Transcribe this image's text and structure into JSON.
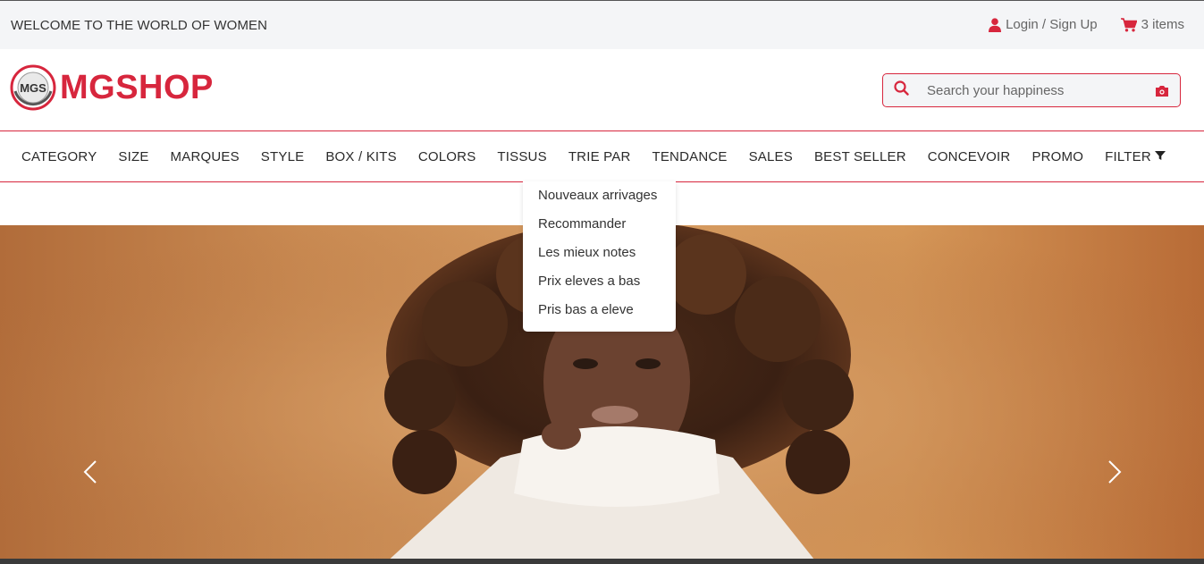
{
  "topbar": {
    "welcome": "WELCOME TO THE WORLD OF WOMEN",
    "login": {
      "label": "Login / Sign Up",
      "icon": "user-icon"
    },
    "cart": {
      "label": "3 items",
      "icon": "cart-icon"
    }
  },
  "header": {
    "logo_badge": "MGS",
    "logo_text": "MGSHOP",
    "search": {
      "placeholder": "Search your happiness",
      "value": ""
    }
  },
  "nav": {
    "items": [
      "CATEGORY",
      "SIZE",
      "MARQUES",
      "STYLE",
      "BOX / KITS",
      "COLORS",
      "TISSUS",
      "TRIE PAR",
      "TENDANCE",
      "SALES",
      "BEST SELLER",
      "CONCEVOIR",
      "PROMO",
      "FILTER"
    ]
  },
  "dropdown": {
    "items": [
      "Nouveaux arrivages",
      "Recommander",
      "Les mieux notes",
      "Prix eleves a bas",
      "Pris bas a eleve"
    ]
  },
  "colors": {
    "accent": "#d7263d",
    "topbar_bg": "#f4f5f7"
  }
}
